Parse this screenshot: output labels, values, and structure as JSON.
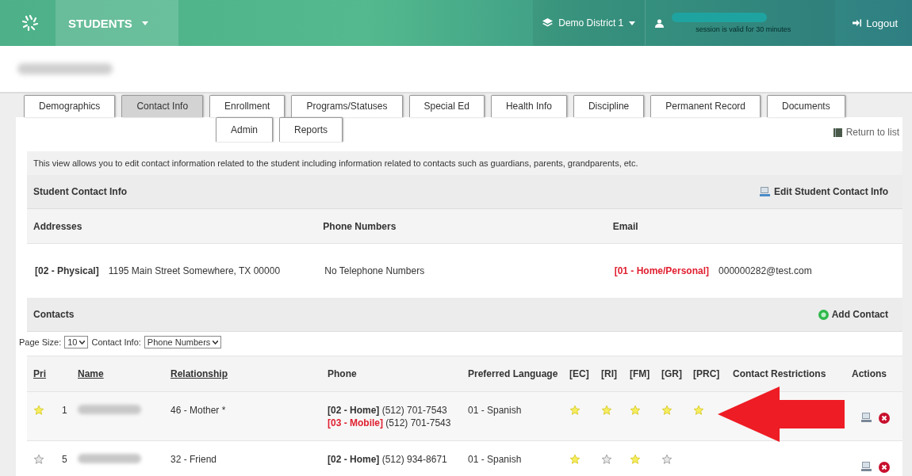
{
  "app": {
    "module": "STUDENTS"
  },
  "district": {
    "label": "Demo District 1"
  },
  "session": {
    "note": "session is valid for 30 minutes"
  },
  "logout": {
    "label": "Logout"
  },
  "tabs": [
    {
      "label": "Demographics",
      "selected": false
    },
    {
      "label": "Contact Info",
      "selected": true
    },
    {
      "label": "Enrollment",
      "selected": false
    },
    {
      "label": "Programs/Statuses",
      "selected": false
    },
    {
      "label": "Special Ed",
      "selected": false
    },
    {
      "label": "Health Info",
      "selected": false
    },
    {
      "label": "Discipline",
      "selected": false
    },
    {
      "label": "Permanent Record",
      "selected": false
    },
    {
      "label": "Documents",
      "selected": false
    },
    {
      "label": "Admin",
      "selected": false
    },
    {
      "label": "Reports",
      "selected": false
    }
  ],
  "return_link": "Return to list",
  "intro": "This view allows you to edit contact information related to the student including information related to contacts such as guardians, parents, grandparents, etc.",
  "student_contact": {
    "title": "Student Contact Info",
    "edit": "Edit Student Contact Info",
    "columns": [
      "Addresses",
      "Phone Numbers",
      "Email"
    ],
    "address": {
      "type": "[02 - Physical]",
      "value": "1195 Main Street Somewhere, TX 00000"
    },
    "phone": "No Telephone Numbers",
    "email": {
      "type": "[01 - Home/Personal]",
      "value": "000000282@test.com"
    }
  },
  "contacts": {
    "title": "Contacts",
    "add": "Add Contact",
    "page_size_label": "Page Size:",
    "page_size": "10",
    "contact_info_label": "Contact Info:",
    "contact_info": "Phone Numbers",
    "columns": [
      {
        "label": "Pri",
        "sortable": true
      },
      {
        "label": "Name",
        "sortable": true
      },
      {
        "label": "Relationship",
        "sortable": true
      },
      {
        "label": "Phone",
        "sortable": false
      },
      {
        "label": "Preferred Language",
        "sortable": false
      },
      {
        "label": "[EC]",
        "sortable": false
      },
      {
        "label": "[RI]",
        "sortable": false
      },
      {
        "label": "[FM]",
        "sortable": false
      },
      {
        "label": "[GR]",
        "sortable": false
      },
      {
        "label": "[PRC]",
        "sortable": false
      },
      {
        "label": "Contact Restrictions",
        "sortable": false
      },
      {
        "label": "Actions",
        "sortable": false
      }
    ],
    "rows": [
      {
        "starred": true,
        "number": "1",
        "relationship": "46 - Mother *",
        "phones": [
          {
            "kind": "home",
            "type": "[02 - Home]",
            "number": "(512) 701-7543"
          },
          {
            "kind": "mobile",
            "type": "[03 - Mobile]",
            "number": "(512) 701-7543"
          }
        ],
        "language": "01 - Spanish",
        "flags": [
          {
            "on": true
          },
          {
            "on": true
          },
          {
            "on": true
          },
          {
            "on": true
          },
          {
            "on": true
          }
        ]
      },
      {
        "starred": false,
        "number": "5",
        "relationship": "32 - Friend",
        "phones": [
          {
            "kind": "home",
            "type": "[02 - Home]",
            "number": "(512) 934-8671"
          }
        ],
        "language": "01 - Spanish",
        "flags": [
          {
            "on": true
          },
          {
            "on": false
          },
          {
            "on": true
          },
          {
            "on": false
          }
        ]
      }
    ]
  }
}
